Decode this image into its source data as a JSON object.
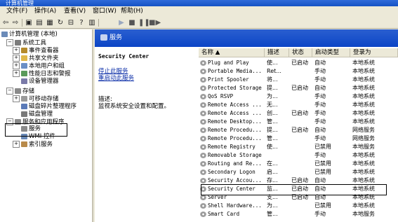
{
  "window": {
    "title": "计算机管理"
  },
  "menu": [
    "文件(F)",
    "操作(A)",
    "查看(V)",
    "窗口(W)",
    "帮助(H)"
  ],
  "tree": [
    {
      "label": "计算机管理 (本地)",
      "indent": 0,
      "toggle": "",
      "icon": "computer-icon",
      "color": "#6a8ab8"
    },
    {
      "label": "系统工具",
      "indent": 1,
      "toggle": "−",
      "icon": "tools-icon",
      "color": "#7b7b7b"
    },
    {
      "label": "事件查看器",
      "indent": 2,
      "toggle": "+",
      "icon": "event-viewer-icon",
      "color": "#b58a2b"
    },
    {
      "label": "共享文件夹",
      "indent": 2,
      "toggle": "+",
      "icon": "shared-folder-icon",
      "color": "#e0b84a"
    },
    {
      "label": "本地用户和组",
      "indent": 2,
      "toggle": "+",
      "icon": "users-icon",
      "color": "#6b8fc6"
    },
    {
      "label": "性能日志和警报",
      "indent": 2,
      "toggle": "+",
      "icon": "performance-icon",
      "color": "#5a9a5a"
    },
    {
      "label": "设备管理器",
      "indent": 2,
      "toggle": "",
      "icon": "device-manager-icon",
      "color": "#7a7aa8"
    },
    {
      "label": "存储",
      "indent": 1,
      "toggle": "−",
      "icon": "storage-icon",
      "color": "#8a8a8a"
    },
    {
      "label": "可移动存储",
      "indent": 2,
      "toggle": "+",
      "icon": "removable-storage-icon",
      "color": "#9a9a9a"
    },
    {
      "label": "磁盘碎片整理程序",
      "indent": 2,
      "toggle": "",
      "icon": "defrag-icon",
      "color": "#5a7ab8"
    },
    {
      "label": "磁盘管理",
      "indent": 2,
      "toggle": "",
      "icon": "disk-management-icon",
      "color": "#7a7a7a"
    },
    {
      "label": "服务和应用程序",
      "indent": 1,
      "toggle": "−",
      "icon": "services-apps-icon",
      "color": "#8a8a8a"
    },
    {
      "label": "服务",
      "indent": 2,
      "toggle": "",
      "icon": "services-icon",
      "color": "#8a8a8a"
    },
    {
      "label": "WMI 控件",
      "indent": 2,
      "toggle": "",
      "icon": "wmi-icon",
      "color": "#6a8ab8"
    },
    {
      "label": "索引服务",
      "indent": 2,
      "toggle": "+",
      "icon": "indexing-icon",
      "color": "#b88a4a"
    }
  ],
  "services_header": "服务",
  "detail": {
    "title": "Security Center",
    "stop_link": "停止此服务",
    "restart_link": "重启动此服务",
    "desc_label": "描述:",
    "desc_text": "监视系统安全设置和配置。"
  },
  "columns": [
    "名称 ▲",
    "描述",
    "状态",
    "启动类型",
    "登录为"
  ],
  "services": [
    {
      "name": "Plug and Play",
      "desc": "使...",
      "status": "已启动",
      "startup": "自动",
      "logon": "本地系统"
    },
    {
      "name": "Portable Media...",
      "desc": "Ret...",
      "status": "",
      "startup": "手动",
      "logon": "本地系统"
    },
    {
      "name": "Print Spooler",
      "desc": "将...",
      "status": "",
      "startup": "手动",
      "logon": "本地系统"
    },
    {
      "name": "Protected Storage",
      "desc": "提...",
      "status": "已启动",
      "startup": "自动",
      "logon": "本地系统"
    },
    {
      "name": "QoS RSVP",
      "desc": "为...",
      "status": "",
      "startup": "手动",
      "logon": "本地系统"
    },
    {
      "name": "Remote Access ...",
      "desc": "无...",
      "status": "",
      "startup": "手动",
      "logon": "本地系统"
    },
    {
      "name": "Remote Access ...",
      "desc": "创...",
      "status": "已启动",
      "startup": "手动",
      "logon": "本地系统"
    },
    {
      "name": "Remote Desktop...",
      "desc": "管...",
      "status": "",
      "startup": "手动",
      "logon": "本地系统"
    },
    {
      "name": "Remote Procedu...",
      "desc": "提...",
      "status": "已启动",
      "startup": "自动",
      "logon": "网络服务"
    },
    {
      "name": "Remote Procedu...",
      "desc": "管...",
      "status": "",
      "startup": "手动",
      "logon": "网络服务"
    },
    {
      "name": "Remote Registry",
      "desc": "使...",
      "status": "",
      "startup": "已禁用",
      "logon": "本地服务"
    },
    {
      "name": "Removable Storage",
      "desc": "",
      "status": "",
      "startup": "手动",
      "logon": "本地系统"
    },
    {
      "name": "Routing and Re...",
      "desc": "在...",
      "status": "",
      "startup": "已禁用",
      "logon": "本地系统"
    },
    {
      "name": "Secondary Logon",
      "desc": "启...",
      "status": "",
      "startup": "已禁用",
      "logon": "本地系统"
    },
    {
      "name": "Security Accou...",
      "desc": "存...",
      "status": "已启动",
      "startup": "自动",
      "logon": "本地系统"
    },
    {
      "name": "Security Center",
      "desc": "监...",
      "status": "已启动",
      "startup": "自动",
      "logon": "本地系统"
    },
    {
      "name": "Server",
      "desc": "支...",
      "status": "已启动",
      "startup": "自动",
      "logon": "本地系统"
    },
    {
      "name": "Shell Hardware...",
      "desc": "为...",
      "status": "",
      "startup": "已禁用",
      "logon": "本地系统"
    },
    {
      "name": "Smart Card",
      "desc": "管...",
      "status": "",
      "startup": "手动",
      "logon": "本地服务"
    }
  ]
}
